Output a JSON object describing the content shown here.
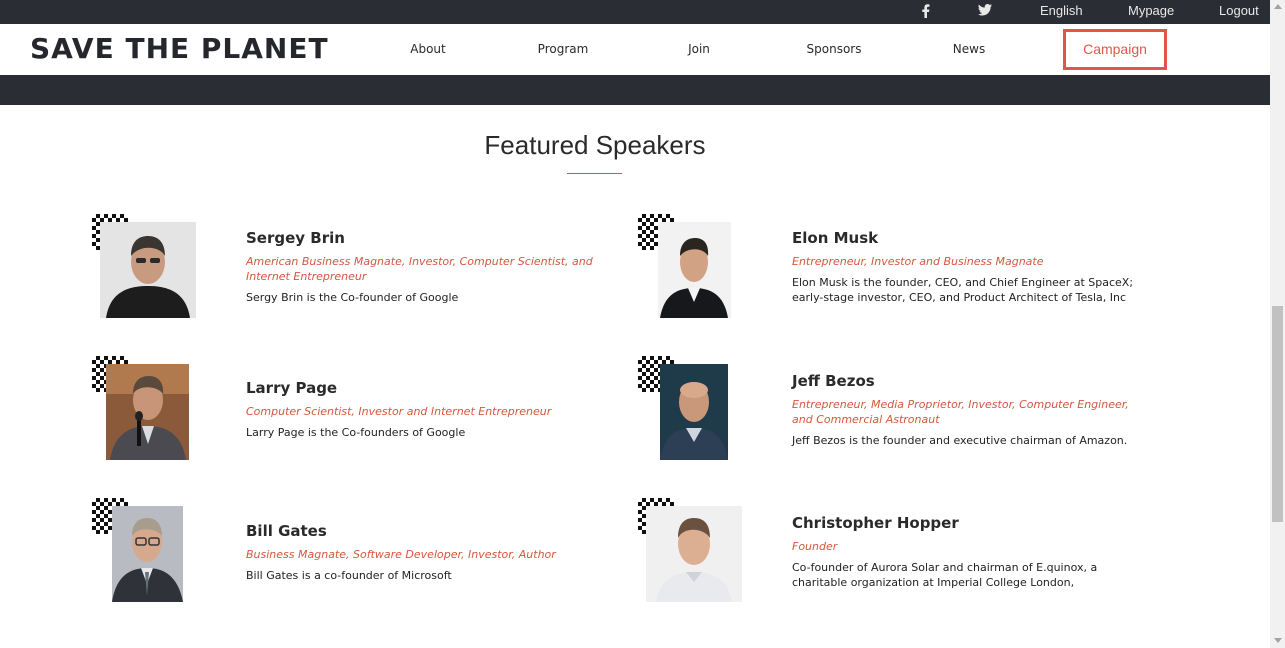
{
  "topbar": {
    "facebook_icon": "facebook-icon",
    "twitter_icon": "twitter-icon",
    "language": "English",
    "mypage": "Mypage",
    "logout": "Logout"
  },
  "header": {
    "brand": "SAVE THE PLANET",
    "nav": [
      "About",
      "Program",
      "Join",
      "Sponsors",
      "News"
    ],
    "campaign": "Campaign"
  },
  "section": {
    "title": "Featured Speakers"
  },
  "speakers": [
    {
      "name": "Sergey Brin",
      "role": "American Business Magnate, Investor, Computer Scientist, and Internet Entrepreneur",
      "desc": "Sergy Brin is the Co-founder of Google"
    },
    {
      "name": "Elon Musk",
      "role": "Entrepreneur, Investor and Business Magnate",
      "desc": "Elon Musk is the founder, CEO, and Chief Engineer at SpaceX; early-stage investor, CEO, and Product Architect of Tesla, Inc"
    },
    {
      "name": "Larry Page",
      "role": "Computer Scientist, Investor and Internet Entrepreneur",
      "desc": "Larry Page is the Co-founders of Google"
    },
    {
      "name": "Jeff Bezos",
      "role": "Entrepreneur, Media Proprietor, Investor, Computer Engineer, and Commercial Astronaut",
      "desc": "Jeff Bezos is the founder and executive chairman of Amazon."
    },
    {
      "name": "Bill Gates",
      "role": "Business Magnate, Software Developer, Investor, Author",
      "desc": "Bill Gates is a co-founder of Microsoft"
    },
    {
      "name": "Christopher Hopper",
      "role": "Founder",
      "desc": "Co-founder of Aurora Solar and chairman of E.quinox, a charitable organization at Imperial College London,"
    }
  ],
  "colors": {
    "dark": "#2b2d35",
    "accent": "#d2583f",
    "campaign_border": "#e0574a"
  }
}
